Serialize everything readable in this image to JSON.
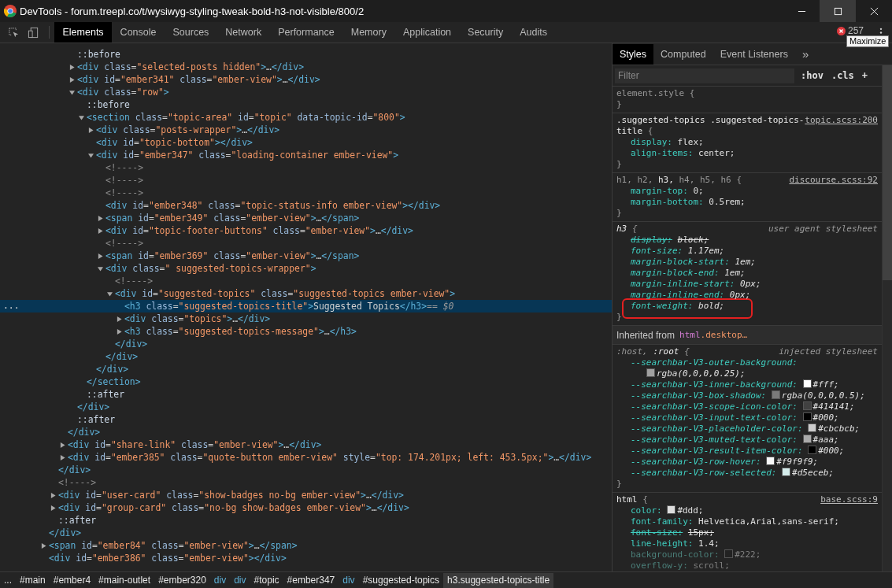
{
  "window": {
    "title": "DevTools - forum.treepl.co/t/wysiwyg-styling-tweak-bold-h3-not-visible/800/2",
    "controls": [
      {
        "kind": "minimize",
        "hovered": false
      },
      {
        "kind": "maximize",
        "hovered": true
      },
      {
        "kind": "close",
        "hovered": false
      }
    ],
    "tooltip": "Maximize"
  },
  "toolbar": {
    "tools": [
      {
        "kind": "inspect"
      },
      {
        "kind": "device"
      }
    ],
    "tabs": [
      {
        "label": "Elements",
        "selected": true
      },
      {
        "label": "Console",
        "selected": false
      },
      {
        "label": "Sources",
        "selected": false
      },
      {
        "label": "Network",
        "selected": false
      },
      {
        "label": "Performance",
        "selected": false
      },
      {
        "label": "Memory",
        "selected": false
      },
      {
        "label": "Application",
        "selected": false
      },
      {
        "label": "Security",
        "selected": false
      },
      {
        "label": "Audits",
        "selected": false
      }
    ],
    "error_count": "257"
  },
  "elements_tree": [
    {
      "closing": "</div>",
      "children": [
        {
          "closing": "</div>",
          "children": [
            {
              "closing": "</div>",
              "children": [
                {
                  "markup": "::before",
                  "selected": false
                },
                {
                  "markup": "<div class=\"selected-posts hidden\">…</div>",
                  "expanded": false,
                  "selected": false
                },
                {
                  "markup": "<div id=\"ember341\" class=\"ember-view\">…</div>",
                  "expanded": false,
                  "selected": false
                },
                {
                  "markup": "<div class=\"row\">",
                  "expanded": true,
                  "selected": false,
                  "closing": "</div>",
                  "children": [
                    {
                      "markup": "::before",
                      "selected": false
                    },
                    {
                      "markup": "<section class=\"topic-area\" id=\"topic\" data-topic-id=\"800\">",
                      "expanded": true,
                      "selected": false,
                      "closing": "</section>",
                      "children": [
                        {
                          "markup": "<div class=\"posts-wrapper\">…</div>",
                          "expanded": false,
                          "selected": false
                        },
                        {
                          "markup": "<div id=\"topic-bottom\"></div>",
                          "selected": false
                        },
                        {
                          "markup": "<div id=\"ember347\" class=\"loading-container ember-view\">",
                          "expanded": true,
                          "selected": false,
                          "closing": "</div>",
                          "children": [
                            {
                              "markup": "<!---->",
                              "selected": false
                            },
                            {
                              "markup": "<!---->",
                              "selected": false
                            },
                            {
                              "markup": "<!---->",
                              "selected": false
                            },
                            {
                              "markup": "<div id=\"ember348\" class=\"topic-status-info ember-view\"></div>",
                              "selected": false
                            },
                            {
                              "markup": "<span id=\"ember349\" class=\"ember-view\">…</span>",
                              "expanded": false,
                              "selected": false
                            },
                            {
                              "markup": "<div id=\"topic-footer-buttons\" class=\"ember-view\">…</div>",
                              "expanded": false,
                              "selected": false
                            },
                            {
                              "markup": "<!---->",
                              "selected": false
                            },
                            {
                              "markup": "<span id=\"ember369\" class=\"ember-view\">…</span>",
                              "expanded": false,
                              "selected": false
                            },
                            {
                              "markup": "<div class=\" suggested-topics-wrapper\">",
                              "expanded": true,
                              "selected": false,
                              "closing": "</div>",
                              "children": [
                                {
                                  "markup": "<!---->",
                                  "selected": false
                                },
                                {
                                  "markup": "<div id=\"suggested-topics\" class=\"suggested-topics ember-view\">",
                                  "expanded": true,
                                  "selected": false,
                                  "closing": "</div>",
                                  "children": [
                                    {
                                      "markup": "<h3 class=\"suggested-topics-title\">Suggested Topics</h3>",
                                      "selected": true,
                                      "gutter": "...",
                                      "suffix": "== $0"
                                    },
                                    {
                                      "markup": "<div class=\"topics\">…</div>",
                                      "expanded": false,
                                      "selected": false
                                    },
                                    {
                                      "markup": "<h3 class=\"suggested-topics-message\">…</h3>",
                                      "expanded": false,
                                      "selected": false
                                    }
                                  ]
                                }
                              ]
                            }
                          ]
                        }
                      ]
                    },
                    {
                      "markup": "::after",
                      "selected": false
                    }
                  ]
                },
                {
                  "markup": "::after",
                  "selected": false
                }
              ]
            },
            {
              "markup": "<div id=\"share-link\" class=\"ember-view\">…</div>",
              "expanded": false,
              "selected": false
            },
            {
              "markup": "<div id=\"ember385\" class=\"quote-button ember-view\" style=\"top: 174.201px; left: 453.5px;\">…</div>",
              "expanded": false,
              "selected": false
            }
          ]
        },
        {
          "markup": "<!---->",
          "selected": false
        },
        {
          "markup": "<div id=\"user-card\" class=\"show-badges no-bg ember-view\">…</div>",
          "expanded": false,
          "selected": false
        },
        {
          "markup": "<div id=\"group-card\" class=\"no-bg show-badges ember-view\">…</div>",
          "expanded": false,
          "selected": false
        },
        {
          "markup": "::after",
          "selected": false
        }
      ]
    },
    {
      "markup": "<span id=\"ember84\" class=\"ember-view\">…</span>",
      "expanded": false,
      "selected": false
    },
    {
      "markup": "<div id=\"ember386\" class=\"ember-view\"></div>",
      "selected": false
    }
  ],
  "breadcrumbs": [
    {
      "text": "...",
      "kind": "overflow",
      "selected": false
    },
    {
      "text": "#main",
      "kind": "id",
      "selected": false
    },
    {
      "text": "#ember4",
      "kind": "id",
      "selected": false
    },
    {
      "text": "#main-outlet",
      "kind": "id",
      "selected": false
    },
    {
      "text": "#ember320",
      "kind": "id",
      "selected": false
    },
    {
      "text": "div",
      "kind": "tag",
      "selected": false
    },
    {
      "text": "div",
      "kind": "tag",
      "selected": false
    },
    {
      "text": "#topic",
      "kind": "id",
      "selected": false
    },
    {
      "text": "#ember347",
      "kind": "id",
      "selected": false
    },
    {
      "text": "div",
      "kind": "tag",
      "selected": false
    },
    {
      "text": "#suggested-topics",
      "kind": "id",
      "selected": false
    },
    {
      "text": "h3.suggested-topics-title",
      "kind": "compound",
      "selected": true
    }
  ],
  "styles_panel": {
    "tabs": [
      {
        "label": "Styles",
        "selected": true
      },
      {
        "label": "Computed",
        "selected": false
      },
      {
        "label": "Event Listeners",
        "selected": false
      }
    ],
    "overflow": "»",
    "filter": {
      "placeholder": "Filter"
    },
    "buttons": [
      ":hov",
      ".cls",
      "+"
    ],
    "blocks": [
      {
        "kind": "rule",
        "selector": [
          {
            "text": "element.style",
            "matched": false
          }
        ],
        "open": "{",
        "close": "}"
      },
      {
        "kind": "rule",
        "selector": [
          {
            "text": ".suggested-topics .suggested-topics-title",
            "matched": true
          }
        ],
        "source": {
          "text": "topic.scss:200",
          "kind": "link"
        },
        "open": "{",
        "close": "}",
        "properties": [
          {
            "name": "display:",
            "value": "flex;",
            "overridden": false,
            "inactive": false,
            "highlighted": false
          },
          {
            "name": "align-items:",
            "value": "center;",
            "overridden": false,
            "inactive": false,
            "highlighted": false
          }
        ]
      },
      {
        "kind": "rule",
        "selector": [
          {
            "text": "h1,",
            "matched": false
          },
          {
            "text": "h2,",
            "matched": false
          },
          {
            "text": "h3,",
            "matched": true
          },
          {
            "text": "h4,",
            "matched": false
          },
          {
            "text": "h5,",
            "matched": false
          },
          {
            "text": "h6",
            "matched": false
          }
        ],
        "source": {
          "text": "discourse.scss:92",
          "kind": "link"
        },
        "open": "{",
        "close": "}",
        "properties": [
          {
            "name": "margin-top:",
            "value": "0;",
            "overridden": false,
            "inactive": false,
            "highlighted": false
          },
          {
            "name": "margin-bottom:",
            "value": "0.5rem;",
            "overridden": false,
            "inactive": false,
            "highlighted": false
          }
        ]
      },
      {
        "kind": "rule",
        "selector": [
          {
            "text": "h3",
            "matched": true
          }
        ],
        "source": {
          "text": "user agent stylesheet",
          "kind": "origin"
        },
        "open": "{",
        "close": "}",
        "properties": [
          {
            "name": "display:",
            "value": "block;",
            "overridden": true,
            "inactive": false,
            "highlighted": false
          },
          {
            "name": "font-size:",
            "value": "1.17em;",
            "overridden": false,
            "inactive": false,
            "highlighted": false
          },
          {
            "name": "margin-block-start:",
            "value": "1em;",
            "overridden": false,
            "inactive": false,
            "highlighted": false
          },
          {
            "name": "margin-block-end:",
            "value": "1em;",
            "overridden": false,
            "inactive": false,
            "highlighted": false
          },
          {
            "name": "margin-inline-start:",
            "value": "0px;",
            "overridden": false,
            "inactive": false,
            "highlighted": false
          },
          {
            "name": "margin-inline-end:",
            "value": "0px;",
            "overridden": false,
            "inactive": false,
            "highlighted": false
          },
          {
            "name": "font-weight:",
            "value": "bold;",
            "overridden": false,
            "inactive": false,
            "highlighted": true
          }
        ]
      },
      {
        "kind": "inherited",
        "label": "Inherited from",
        "target": [
          {
            "text": "html",
            "kind": "tag"
          },
          {
            "text": ".desktop…",
            "kind": "class"
          }
        ]
      },
      {
        "kind": "rule",
        "selector": [
          {
            "text": ":host,",
            "matched": false
          },
          {
            "text": ":root",
            "matched": true
          }
        ],
        "source": {
          "text": "injected stylesheet",
          "kind": "origin"
        },
        "open": "{",
        "close": "}",
        "properties": [
          {
            "name": "--searchbar-V3-outer-background:",
            "value": "rgba(0,0,0,0.25);",
            "color": "#a0a0a0",
            "overridden": false,
            "inactive": false,
            "highlighted": false
          },
          {
            "name": "--searchbar-V3-inner-background:",
            "value": "#fff;",
            "color": "#ffffff",
            "overridden": false,
            "inactive": false,
            "highlighted": false
          },
          {
            "name": "--searchbar-V3-box-shadow:",
            "value": "rgba(0,0,0,0.5);",
            "color": "#7a7a7a",
            "overridden": false,
            "inactive": false,
            "highlighted": false
          },
          {
            "name": "--searchbar-V3-scope-icon-color:",
            "value": "#414141;",
            "color": "#414141",
            "overridden": false,
            "inactive": false,
            "highlighted": false
          },
          {
            "name": "--searchbar-V3-input-text-color:",
            "value": "#000;",
            "color": "#000000",
            "overridden": false,
            "inactive": false,
            "highlighted": false
          },
          {
            "name": "--searchbar-V3-placeholder-color:",
            "value": "#cbcbcb;",
            "color": "#cbcbcb",
            "overridden": false,
            "inactive": false,
            "highlighted": false
          },
          {
            "name": "--searchbar-V3-muted-text-color:",
            "value": "#aaa;",
            "color": "#aaaaaa",
            "overridden": false,
            "inactive": false,
            "highlighted": false
          },
          {
            "name": "--searchbar-V3-result-item-color:",
            "value": "#000;",
            "color": "#000000",
            "overridden": false,
            "inactive": false,
            "highlighted": false
          },
          {
            "name": "--searchbar-V3-row-hover:",
            "value": "#f9f9f9;",
            "color": "#f9f9f9",
            "overridden": false,
            "inactive": false,
            "highlighted": false
          },
          {
            "name": "--searchbar-V3-row-selected:",
            "value": "#d5eceb;",
            "color": "#d5eceb",
            "overridden": false,
            "inactive": false,
            "highlighted": false
          }
        ]
      },
      {
        "kind": "rule",
        "selector": [
          {
            "text": "html",
            "matched": true
          }
        ],
        "source": {
          "text": "base.scss:9",
          "kind": "link"
        },
        "open": "{",
        "properties": [
          {
            "name": "color:",
            "value": "#ddd;",
            "color": "#dddddd",
            "overridden": false,
            "inactive": false,
            "highlighted": false
          },
          {
            "name": "font-family:",
            "value": "Helvetica,Arial,sans-serif;",
            "overridden": false,
            "inactive": false,
            "highlighted": false
          },
          {
            "name": "font-size:",
            "value": "15px;",
            "overridden": true,
            "inactive": false,
            "highlighted": false
          },
          {
            "name": "line-height:",
            "value": "1.4;",
            "overridden": false,
            "inactive": false,
            "highlighted": false
          },
          {
            "name": "background-color:",
            "value": "#222;",
            "color": "#222222",
            "overridden": false,
            "inactive": true,
            "highlighted": false
          },
          {
            "name": "overflow-y:",
            "value": "scroll;",
            "overridden": false,
            "inactive": true,
            "highlighted": false
          }
        ]
      }
    ]
  }
}
